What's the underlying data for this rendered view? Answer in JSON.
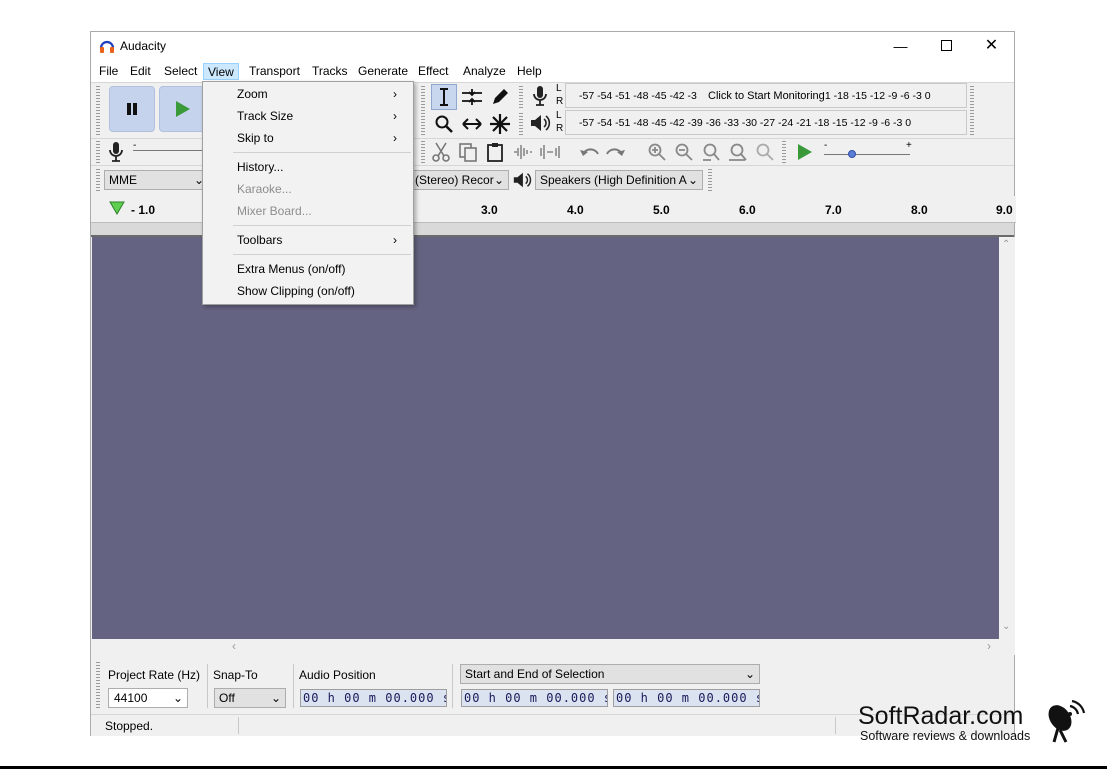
{
  "window": {
    "title": "Audacity"
  },
  "menubar": [
    "File",
    "Edit",
    "Select",
    "View",
    "Transport",
    "Tracks",
    "Generate",
    "Effect",
    "Analyze",
    "Help"
  ],
  "view_menu": {
    "items": [
      {
        "label": "Zoom",
        "submenu": true,
        "enabled": true
      },
      {
        "label": "Track Size",
        "submenu": true,
        "enabled": true
      },
      {
        "label": "Skip to",
        "submenu": true,
        "enabled": true
      },
      {
        "label": "History...",
        "submenu": false,
        "enabled": true
      },
      {
        "label": "Karaoke...",
        "submenu": false,
        "enabled": false
      },
      {
        "label": "Mixer Board...",
        "submenu": false,
        "enabled": false
      },
      {
        "label": "Toolbars",
        "submenu": true,
        "enabled": true
      },
      {
        "label": "Extra Menus (on/off)",
        "submenu": false,
        "enabled": true
      },
      {
        "label": "Show Clipping (on/off)",
        "submenu": false,
        "enabled": true
      }
    ]
  },
  "meters": {
    "record_scale": "-57 -54 -51 -48 -45 -42 -3",
    "record_hint": "Click to Start Monitoring",
    "record_scale_tail": "!1 -18 -15 -12  -9  -6  -3  0",
    "play_scale": "-57 -54 -51 -48 -45 -42 -39 -36 -33 -30 -27 -24 -21 -18 -15 -12  -9  -6  -3  0",
    "left_label": "L",
    "right_label": "R"
  },
  "device": {
    "host": "MME",
    "record_device": "(Stereo) Recor",
    "playback_device": "Speakers (High Definition A"
  },
  "ruler": {
    "labels": [
      "- 1.0",
      "3.0",
      "4.0",
      "5.0",
      "6.0",
      "7.0",
      "8.0",
      "9.0"
    ]
  },
  "selection_toolbar": {
    "project_rate_label": "Project Rate (Hz)",
    "project_rate_value": "44100",
    "snap_label": "Snap-To",
    "snap_value": "Off",
    "audio_position_label": "Audio Position",
    "audio_position_value": "00 h 00 m 00.000 s",
    "selection_mode": "Start and End of Selection",
    "selection_start": "00 h 00 m 00.000 s",
    "selection_end": "00 h 00 m 00.000 s"
  },
  "status": {
    "text": "Stopped."
  },
  "watermark": {
    "brand": "SoftRadar.com",
    "tagline": "Software reviews & downloads"
  },
  "colors": {
    "track_bg": "#646482",
    "menu_highlight": "#cce8ff",
    "play_green": "#3a9a3a"
  }
}
